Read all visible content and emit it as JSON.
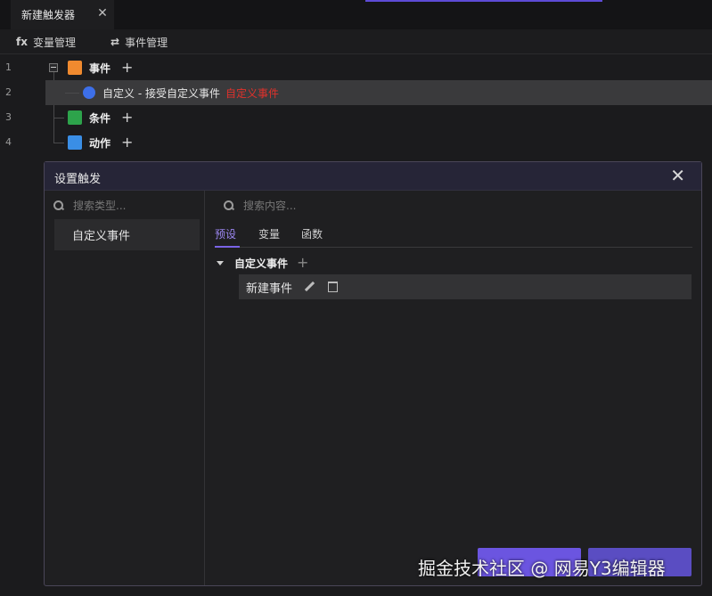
{
  "tab": {
    "label": "新建触发器",
    "close": "✕"
  },
  "toolbar": {
    "vars_icon": "fx",
    "vars_label": "变量管理",
    "events_icon": "⇄",
    "events_label": "事件管理"
  },
  "tree": {
    "lines": [
      "1",
      "2",
      "3",
      "4"
    ],
    "event_label": "事件",
    "custom_text": "自定义 - 接受自定义事件",
    "custom_tag": "自定义事件",
    "cond_label": "条件",
    "action_label": "动作",
    "plus": "+"
  },
  "dialog": {
    "title": "设置触发",
    "close": "✕",
    "left_search_placeholder": "搜索类型...",
    "type_item": "自定义事件",
    "right_search_placeholder": "搜索内容...",
    "tabs": [
      "预设",
      "变量",
      "函数"
    ],
    "group_label": "自定义事件",
    "group_plus": "+",
    "event_item": "新建事件"
  },
  "watermark": "掘金技术社区 @ 网易Y3编辑器",
  "colors": {
    "accent": "#7a63e6",
    "event_icon": "#f08a2f",
    "cond_icon": "#2da34b",
    "action_icon": "#3a8ee6",
    "tag_red": "#e0312b"
  }
}
